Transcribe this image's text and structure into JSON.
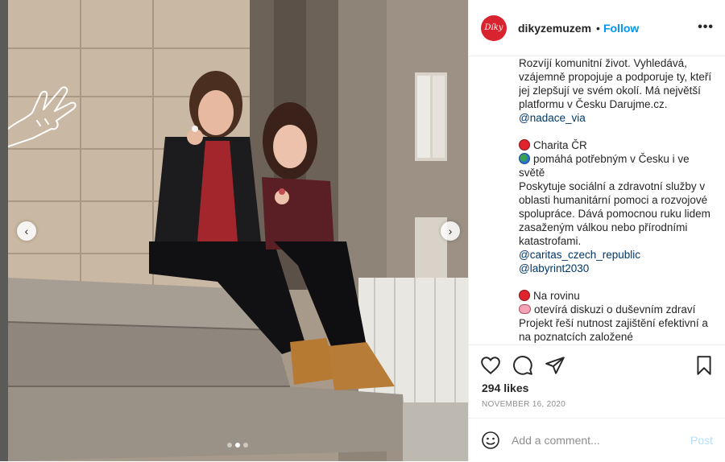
{
  "post": {
    "avatar_text": "Díky",
    "username": "dikyzemuzem",
    "separator": "•",
    "follow_label": "Follow",
    "more_label": "•••",
    "brand_color": "#d9232e",
    "link_color": "#0095f6"
  },
  "photo": {
    "prev_label": "‹",
    "next_label": "›",
    "carousel_total": 3,
    "carousel_active": 2
  },
  "caption": {
    "top_line": "Rozvíjí komunitní život. Vyhledává, vzájemně propojuje a podporuje ty, kteří jej zlepšují ve svém okolí. Má největší platformu v Česku Darujme.cz.",
    "mention_1": "@nadace_via",
    "org2_name": "Charita ČR",
    "org2_tagline": "pomáhá potřebným v Česku i ve světě",
    "org2_desc": "Poskytuje sociální a zdravotní služby v oblasti humanitární pomoci a rozvojové spolupráce. Dává pomocnou ruku lidem zasaženým válkou nebo přírodními katastrofami.",
    "mention_2": "@caritas_czech_republic",
    "mention_3": "@labyrint2030",
    "org3_name": "Na rovinu",
    "org3_tagline": "otevírá diskuzi o duševním zdraví",
    "org3_desc": "Projekt řeší nutnost zajištění efektivní a na poznatcích založené"
  },
  "actions": {
    "likes": "294 likes",
    "date": "NOVEMBER 16, 2020",
    "comment_placeholder": "Add a comment...",
    "post_label": "Post"
  }
}
